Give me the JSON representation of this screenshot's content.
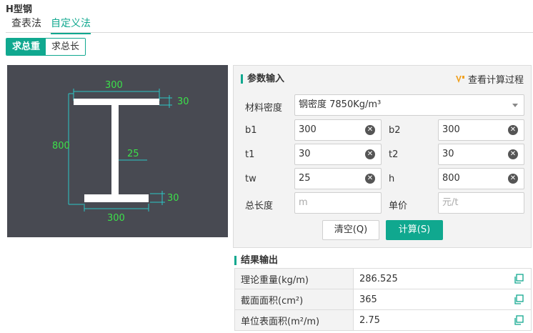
{
  "header": {
    "title": "H型钢"
  },
  "tabs": [
    {
      "label": "查表法"
    },
    {
      "label": "自定义法"
    }
  ],
  "segment": [
    {
      "label": "求总重"
    },
    {
      "label": "求总长"
    }
  ],
  "drawing": {
    "top_width": "300",
    "top_thickness": "30",
    "height": "800",
    "web_thickness": "25",
    "bottom_thickness": "30",
    "bottom_width": "300",
    "line_color": "#2cc7c7",
    "text_color": "#3ce04a"
  },
  "params": {
    "title": "参数输入",
    "calc_process": "查看计算过程",
    "material_label": "材料密度",
    "material_value": "钢密度 7850Kg/m³",
    "b1_label": "b1",
    "b1_value": "300",
    "b2_label": "b2",
    "b2_value": "300",
    "t1_label": "t1",
    "t1_value": "30",
    "t2_label": "t2",
    "t2_value": "30",
    "tw_label": "tw",
    "tw_value": "25",
    "h_label": "h",
    "h_value": "800",
    "length_label": "总长度",
    "length_placeholder": "m",
    "price_label": "单价",
    "price_placeholder": "元/t",
    "clear_btn": "清空(Q)",
    "calc_btn": "计算(S)"
  },
  "results": {
    "title": "结果输出",
    "rows": [
      {
        "label": "理论重量(kg/m)",
        "value": "286.525"
      },
      {
        "label": "截面面积(cm²)",
        "value": "365"
      },
      {
        "label": "单位表面积(m²/m)",
        "value": "2.75"
      }
    ]
  },
  "colors": {
    "accent": "#10a88f",
    "drawing_bg": "#484a52"
  }
}
